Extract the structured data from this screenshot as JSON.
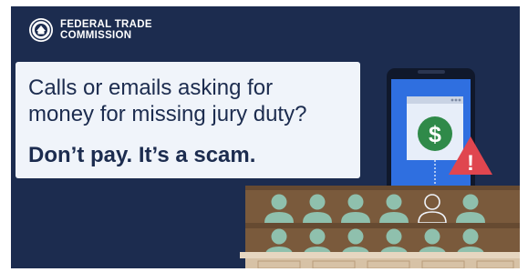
{
  "agency": {
    "line1": "FEDERAL TRADE",
    "line2": "COMMISSION"
  },
  "message": {
    "line1": "Calls or emails asking for",
    "line2": "money for missing jury duty?",
    "emphasis": "Don’t pay. It’s a scam."
  },
  "phone": {
    "coin_symbol": "$",
    "warning_symbol": "!"
  },
  "colors": {
    "background": "#1c2c4f",
    "phone_blue": "#2f6fe0",
    "dollar_green": "#2f8a49",
    "warning_red": "#e0464f",
    "jury_box_wood": "#7a5a3c",
    "juror_teal": "#8fc0ad",
    "text_box": "#f0f4fa"
  },
  "icons": [
    "ftc-seal-icon",
    "dollar-coin-icon",
    "warning-triangle-icon",
    "juror-icon",
    "empty-seat-icon"
  ]
}
